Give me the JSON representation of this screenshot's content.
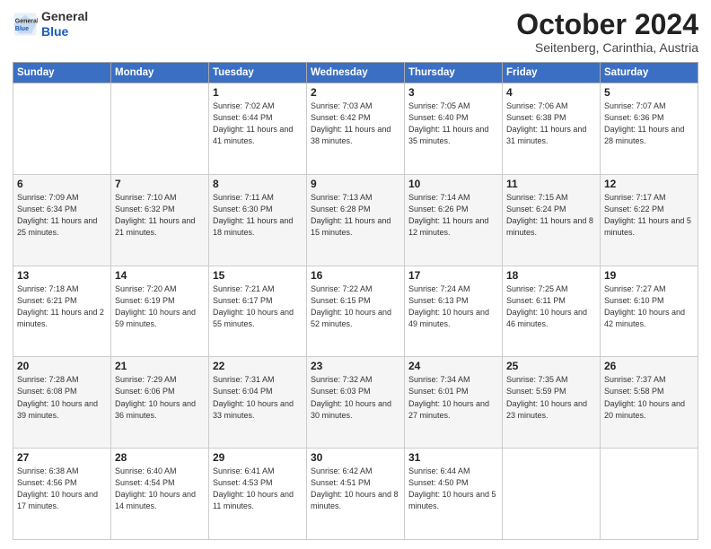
{
  "logo": {
    "line1": "General",
    "line2": "Blue"
  },
  "header": {
    "month": "October 2024",
    "location": "Seitenberg, Carinthia, Austria"
  },
  "days_of_week": [
    "Sunday",
    "Monday",
    "Tuesday",
    "Wednesday",
    "Thursday",
    "Friday",
    "Saturday"
  ],
  "weeks": [
    [
      {
        "day": "",
        "info": ""
      },
      {
        "day": "",
        "info": ""
      },
      {
        "day": "1",
        "info": "Sunrise: 7:02 AM\nSunset: 6:44 PM\nDaylight: 11 hours and 41 minutes."
      },
      {
        "day": "2",
        "info": "Sunrise: 7:03 AM\nSunset: 6:42 PM\nDaylight: 11 hours and 38 minutes."
      },
      {
        "day": "3",
        "info": "Sunrise: 7:05 AM\nSunset: 6:40 PM\nDaylight: 11 hours and 35 minutes."
      },
      {
        "day": "4",
        "info": "Sunrise: 7:06 AM\nSunset: 6:38 PM\nDaylight: 11 hours and 31 minutes."
      },
      {
        "day": "5",
        "info": "Sunrise: 7:07 AM\nSunset: 6:36 PM\nDaylight: 11 hours and 28 minutes."
      }
    ],
    [
      {
        "day": "6",
        "info": "Sunrise: 7:09 AM\nSunset: 6:34 PM\nDaylight: 11 hours and 25 minutes."
      },
      {
        "day": "7",
        "info": "Sunrise: 7:10 AM\nSunset: 6:32 PM\nDaylight: 11 hours and 21 minutes."
      },
      {
        "day": "8",
        "info": "Sunrise: 7:11 AM\nSunset: 6:30 PM\nDaylight: 11 hours and 18 minutes."
      },
      {
        "day": "9",
        "info": "Sunrise: 7:13 AM\nSunset: 6:28 PM\nDaylight: 11 hours and 15 minutes."
      },
      {
        "day": "10",
        "info": "Sunrise: 7:14 AM\nSunset: 6:26 PM\nDaylight: 11 hours and 12 minutes."
      },
      {
        "day": "11",
        "info": "Sunrise: 7:15 AM\nSunset: 6:24 PM\nDaylight: 11 hours and 8 minutes."
      },
      {
        "day": "12",
        "info": "Sunrise: 7:17 AM\nSunset: 6:22 PM\nDaylight: 11 hours and 5 minutes."
      }
    ],
    [
      {
        "day": "13",
        "info": "Sunrise: 7:18 AM\nSunset: 6:21 PM\nDaylight: 11 hours and 2 minutes."
      },
      {
        "day": "14",
        "info": "Sunrise: 7:20 AM\nSunset: 6:19 PM\nDaylight: 10 hours and 59 minutes."
      },
      {
        "day": "15",
        "info": "Sunrise: 7:21 AM\nSunset: 6:17 PM\nDaylight: 10 hours and 55 minutes."
      },
      {
        "day": "16",
        "info": "Sunrise: 7:22 AM\nSunset: 6:15 PM\nDaylight: 10 hours and 52 minutes."
      },
      {
        "day": "17",
        "info": "Sunrise: 7:24 AM\nSunset: 6:13 PM\nDaylight: 10 hours and 49 minutes."
      },
      {
        "day": "18",
        "info": "Sunrise: 7:25 AM\nSunset: 6:11 PM\nDaylight: 10 hours and 46 minutes."
      },
      {
        "day": "19",
        "info": "Sunrise: 7:27 AM\nSunset: 6:10 PM\nDaylight: 10 hours and 42 minutes."
      }
    ],
    [
      {
        "day": "20",
        "info": "Sunrise: 7:28 AM\nSunset: 6:08 PM\nDaylight: 10 hours and 39 minutes."
      },
      {
        "day": "21",
        "info": "Sunrise: 7:29 AM\nSunset: 6:06 PM\nDaylight: 10 hours and 36 minutes."
      },
      {
        "day": "22",
        "info": "Sunrise: 7:31 AM\nSunset: 6:04 PM\nDaylight: 10 hours and 33 minutes."
      },
      {
        "day": "23",
        "info": "Sunrise: 7:32 AM\nSunset: 6:03 PM\nDaylight: 10 hours and 30 minutes."
      },
      {
        "day": "24",
        "info": "Sunrise: 7:34 AM\nSunset: 6:01 PM\nDaylight: 10 hours and 27 minutes."
      },
      {
        "day": "25",
        "info": "Sunrise: 7:35 AM\nSunset: 5:59 PM\nDaylight: 10 hours and 23 minutes."
      },
      {
        "day": "26",
        "info": "Sunrise: 7:37 AM\nSunset: 5:58 PM\nDaylight: 10 hours and 20 minutes."
      }
    ],
    [
      {
        "day": "27",
        "info": "Sunrise: 6:38 AM\nSunset: 4:56 PM\nDaylight: 10 hours and 17 minutes."
      },
      {
        "day": "28",
        "info": "Sunrise: 6:40 AM\nSunset: 4:54 PM\nDaylight: 10 hours and 14 minutes."
      },
      {
        "day": "29",
        "info": "Sunrise: 6:41 AM\nSunset: 4:53 PM\nDaylight: 10 hours and 11 minutes."
      },
      {
        "day": "30",
        "info": "Sunrise: 6:42 AM\nSunset: 4:51 PM\nDaylight: 10 hours and 8 minutes."
      },
      {
        "day": "31",
        "info": "Sunrise: 6:44 AM\nSunset: 4:50 PM\nDaylight: 10 hours and 5 minutes."
      },
      {
        "day": "",
        "info": ""
      },
      {
        "day": "",
        "info": ""
      }
    ]
  ]
}
